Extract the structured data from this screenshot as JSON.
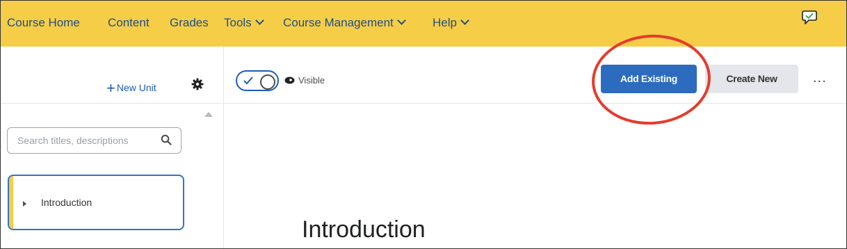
{
  "topnav": {
    "items": [
      {
        "label": "Course Home",
        "dropdown": false
      },
      {
        "label": "Content",
        "dropdown": false
      },
      {
        "label": "Grades",
        "dropdown": false
      },
      {
        "label": "Tools",
        "dropdown": true
      },
      {
        "label": "Course Management",
        "dropdown": true
      },
      {
        "label": "Help",
        "dropdown": true
      }
    ],
    "icon": "chat-check-icon",
    "background": "#f6cd47"
  },
  "sidebar": {
    "new_unit_label": "New Unit",
    "search_placeholder": "Search titles, descriptions",
    "units": [
      {
        "label": "Introduction"
      }
    ]
  },
  "toolbar": {
    "visibility_label": "Visible",
    "add_existing_label": "Add Existing",
    "create_new_label": "Create New",
    "more_label": "..."
  },
  "main": {
    "heading": "Introduction"
  },
  "colors": {
    "accent": "#2d6bbf",
    "highlight_circle": "#e53b2c",
    "nav_text": "#1e4f86"
  }
}
